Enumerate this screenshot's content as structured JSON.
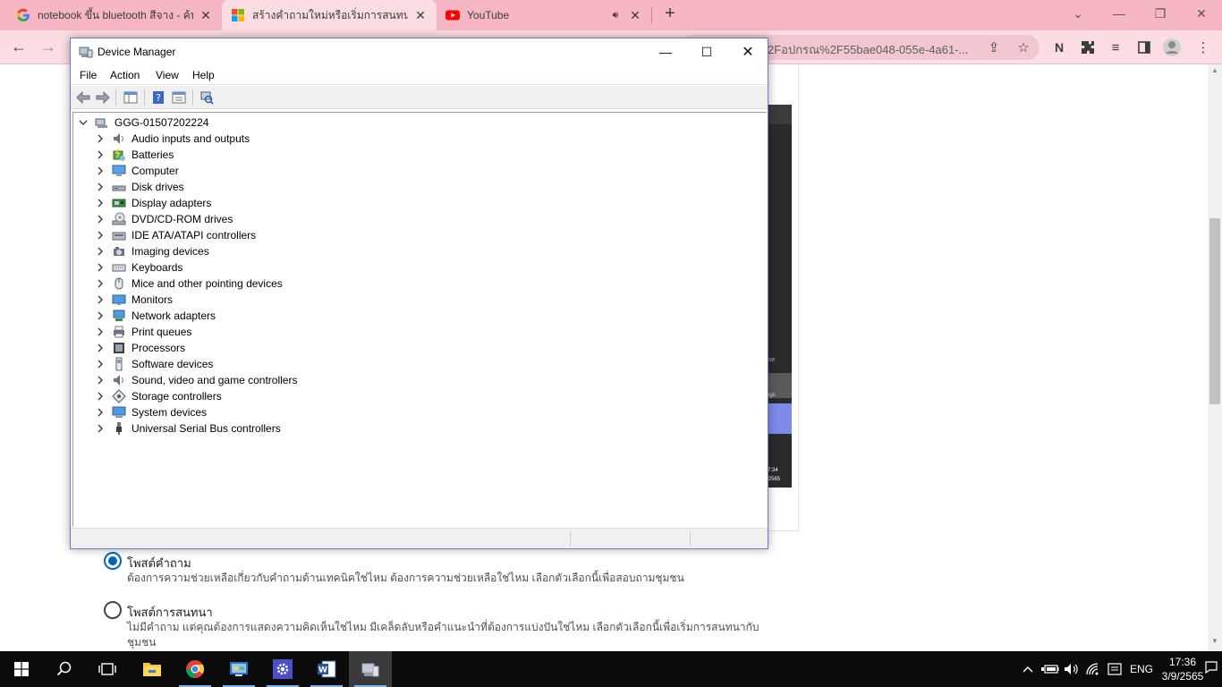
{
  "browser": {
    "tabs": [
      {
        "title": "notebook ขึ้น bluetooth สีจาง - ค้น",
        "favicon": "google-icon",
        "active": false
      },
      {
        "title": "สร้างคำถามใหม่หรือเริ่มการสนทนา",
        "favicon": "microsoft-icon",
        "active": true
      },
      {
        "title": "YouTube",
        "favicon": "youtube-icon",
        "active": false,
        "audio": true
      }
    ],
    "new_tab_glyph": "+",
    "address_fragment": "2Fอปกรณ%2F55bae048-055e-4a61-..."
  },
  "device_manager": {
    "title": "Device Manager",
    "menu": [
      "File",
      "Action",
      "View",
      "Help"
    ],
    "root": "GGG-01507202224",
    "categories": [
      {
        "label": "Audio inputs and outputs",
        "icon": "speaker-icon"
      },
      {
        "label": "Batteries",
        "icon": "battery-icon"
      },
      {
        "label": "Computer",
        "icon": "computer-icon"
      },
      {
        "label": "Disk drives",
        "icon": "disk-drive-icon"
      },
      {
        "label": "Display adapters",
        "icon": "display-adapter-icon"
      },
      {
        "label": "DVD/CD-ROM drives",
        "icon": "dvd-icon"
      },
      {
        "label": "IDE ATA/ATAPI controllers",
        "icon": "ide-controller-icon"
      },
      {
        "label": "Imaging devices",
        "icon": "camera-icon"
      },
      {
        "label": "Keyboards",
        "icon": "keyboard-icon"
      },
      {
        "label": "Mice and other pointing devices",
        "icon": "mouse-icon"
      },
      {
        "label": "Monitors",
        "icon": "monitor-icon"
      },
      {
        "label": "Network adapters",
        "icon": "network-adapter-icon"
      },
      {
        "label": "Print queues",
        "icon": "printer-icon"
      },
      {
        "label": "Processors",
        "icon": "processor-icon"
      },
      {
        "label": "Software devices",
        "icon": "software-device-icon"
      },
      {
        "label": "Sound, video and game controllers",
        "icon": "speaker-icon"
      },
      {
        "label": "Storage controllers",
        "icon": "storage-controller-icon"
      },
      {
        "label": "System devices",
        "icon": "system-device-icon"
      },
      {
        "label": "Universal Serial Bus controllers",
        "icon": "usb-icon"
      }
    ]
  },
  "page": {
    "options": [
      {
        "title": "โพสต์คำถาม",
        "desc": "ต้องการความช่วยเหลือเกี่ยวกับคำถามด้านเทคนิคใช่ไหม ต้องการความช่วยเหลือใช่ไหม เลือกตัวเลือกนี้เพื่อสอบถามชุมชน",
        "selected": true
      },
      {
        "title": "โพสต์การสนทนา",
        "desc": "ไม่มีคำถาม แต่คุณต้องการแสดงความคิดเห็นใช่ไหม มีเคล็ดลับหรือคำแนะนำที่ต้องการแบ่งปันใช่ไหม เลือกตัวเลือกนี้เพื่อเริ่มการสนทนากับชุมชน",
        "selected": false
      }
    ],
    "embedded_fragments": [
      "se",
      "ngs",
      "7:34",
      "/2565"
    ]
  },
  "taskbar": {
    "apps": [
      "start-icon",
      "search-icon",
      "task-view-icon",
      "file-explorer-icon",
      "chrome-icon",
      "control-panel-icon",
      "settings-icon",
      "word-icon",
      "device-manager-icon"
    ],
    "language": "ENG",
    "time": "17:36",
    "date": "3/9/2565"
  },
  "colors": {
    "tabstrip": "#f7b6c3",
    "toolbar": "#fbdde3",
    "accent": "#0067b8",
    "window_border": "#6f77d0"
  }
}
